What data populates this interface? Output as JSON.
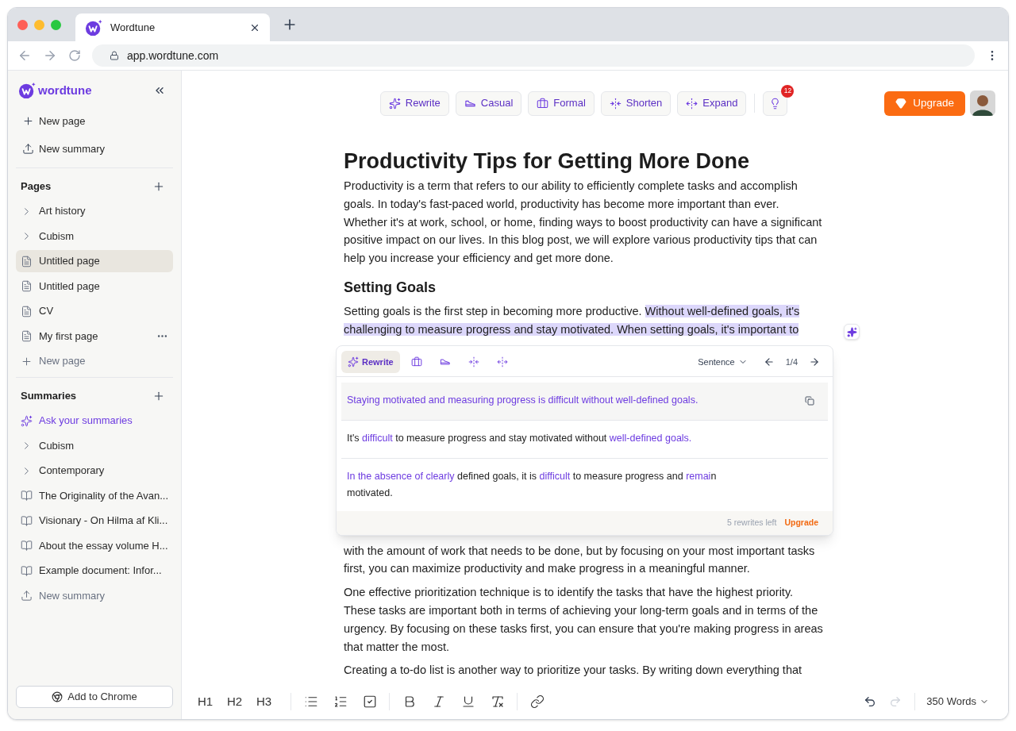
{
  "browser": {
    "tab_title": "Wordtune",
    "url": "app.wordtune.com"
  },
  "sidebar": {
    "logo": "wordtune",
    "actions": [
      {
        "label": "New page",
        "kind": "add"
      },
      {
        "label": "New summary",
        "kind": "upload"
      }
    ],
    "sections": [
      {
        "title": "Pages",
        "items": [
          {
            "label": "Art history",
            "kind": "folder",
            "selected": false
          },
          {
            "label": "Cubism",
            "kind": "folder",
            "selected": false
          },
          {
            "label": "Untitled page",
            "kind": "page",
            "selected": true
          },
          {
            "label": "Untitled page",
            "kind": "page",
            "selected": false
          },
          {
            "label": "CV",
            "kind": "page",
            "selected": false
          },
          {
            "label": "My first page",
            "kind": "page",
            "selected": false,
            "more": true
          },
          {
            "label": "New page",
            "kind": "add",
            "selected": false
          }
        ]
      },
      {
        "title": "Summaries",
        "items": [
          {
            "label": "Ask your summaries",
            "kind": "ask",
            "selected": false
          },
          {
            "label": "Cubism",
            "kind": "folder",
            "selected": false
          },
          {
            "label": "Contemporary",
            "kind": "folder",
            "selected": false
          },
          {
            "label": "The Originality of the Avan...",
            "kind": "book",
            "selected": false
          },
          {
            "label": "Visionary - On Hilma af Kli...",
            "kind": "book",
            "selected": false
          },
          {
            "label": "About the essay volume H...",
            "kind": "book",
            "selected": false
          },
          {
            "label": "Example document: Infor...",
            "kind": "book",
            "selected": false
          },
          {
            "label": "New summary",
            "kind": "upload",
            "selected": false
          }
        ]
      }
    ],
    "add_to_chrome": "Add to Chrome"
  },
  "toolbar": {
    "tools": [
      {
        "label": "Rewrite",
        "kind": "rewrite"
      },
      {
        "label": "Casual",
        "kind": "casual"
      },
      {
        "label": "Formal",
        "kind": "formal"
      },
      {
        "label": "Shorten",
        "kind": "shorten"
      },
      {
        "label": "Expand",
        "kind": "expand"
      }
    ],
    "tips_badge": "12",
    "upgrade": "Upgrade"
  },
  "document": {
    "title": "Productivity Tips for Getting More Done",
    "blocks": [
      {
        "kind": "paragraph",
        "segments": [
          {
            "text": "Productivity is a term that refers to our ability to efficiently complete tasks and accomplish goals. In today's fast-paced world, productivity has become more important than ever. Whether it's at work, school, or home, finding ways to boost productivity can have a significant positive impact on our lives. In this blog post, we will explore various productivity tips that can help you increase your efficiency and get more done.",
            "highlighted": false
          }
        ]
      },
      {
        "kind": "heading",
        "segments": [
          {
            "text": "Setting Goals",
            "highlighted": false
          }
        ]
      },
      {
        "kind": "paragraph",
        "segments": [
          {
            "text": "Setting goals is the first step in becoming more productive. ",
            "highlighted": false
          },
          {
            "text": "Without well-defined goals, it's challenging to measure progress and stay motivated. When setting goals, it's important to",
            "highlighted": true
          }
        ]
      },
      {
        "kind": "popup"
      },
      {
        "kind": "paragraph",
        "segments": [
          {
            "text": "with the amount of work that needs to be done, but by focusing on your most important tasks first, you can maximize productivity and make progress in a meaningful manner.",
            "highlighted": false
          }
        ]
      },
      {
        "kind": "paragraph",
        "segments": [
          {
            "text": "One effective prioritization technique is to identify the tasks that have the highest priority. These tasks are important both in terms of achieving your long-term goals and in terms of the urgency. By focusing on these tasks first, you can ensure that you're making progress in areas that matter the most.",
            "highlighted": false
          }
        ]
      },
      {
        "kind": "paragraph",
        "segments": [
          {
            "text": "Creating a to-do list is another way to prioritize your tasks. By writing down everything that",
            "highlighted": false
          }
        ]
      }
    ]
  },
  "popup": {
    "tabs": [
      {
        "label": "Rewrite",
        "kind": "rewrite",
        "selected": true
      },
      {
        "kind": "formal",
        "selected": false
      },
      {
        "kind": "casual",
        "selected": false
      },
      {
        "kind": "shorten",
        "selected": false
      },
      {
        "kind": "expand",
        "selected": false
      }
    ],
    "mode": "Sentence",
    "counter": "1/4",
    "suggestions": [
      {
        "selected": true,
        "segments": [
          {
            "text": "Staying motivated and measuring progress is difficult without well-defined goals.",
            "changed": true
          }
        ]
      },
      {
        "selected": false,
        "segments": [
          {
            "text": "It's ",
            "changed": false
          },
          {
            "text": "difficult",
            "changed": true
          },
          {
            "text": " to measure progress and stay motivated without ",
            "changed": false
          },
          {
            "text": "well-defined goals.",
            "changed": true
          }
        ]
      },
      {
        "selected": false,
        "segments": [
          {
            "text": "In the absence of clearly",
            "changed": true
          },
          {
            "text": " defined goals, it is ",
            "changed": false
          },
          {
            "text": "difficult",
            "changed": true
          },
          {
            "text": " to measure progress and ",
            "changed": false
          },
          {
            "text": "remai",
            "changed": true
          },
          {
            "text": "n motivated.",
            "changed": false
          }
        ]
      }
    ],
    "rewrites_left": "5 rewrites left",
    "upgrade": "Upgrade"
  },
  "format_bar": {
    "headings": [
      "H1",
      "H2",
      "H3"
    ],
    "tools": [
      {
        "kind": "bullets"
      },
      {
        "kind": "numbers"
      },
      {
        "kind": "checklist"
      },
      {
        "kind": "bold"
      },
      {
        "kind": "italic"
      },
      {
        "kind": "underline"
      },
      {
        "kind": "clear"
      },
      {
        "kind": "link"
      }
    ],
    "word_count": "350 Words"
  }
}
